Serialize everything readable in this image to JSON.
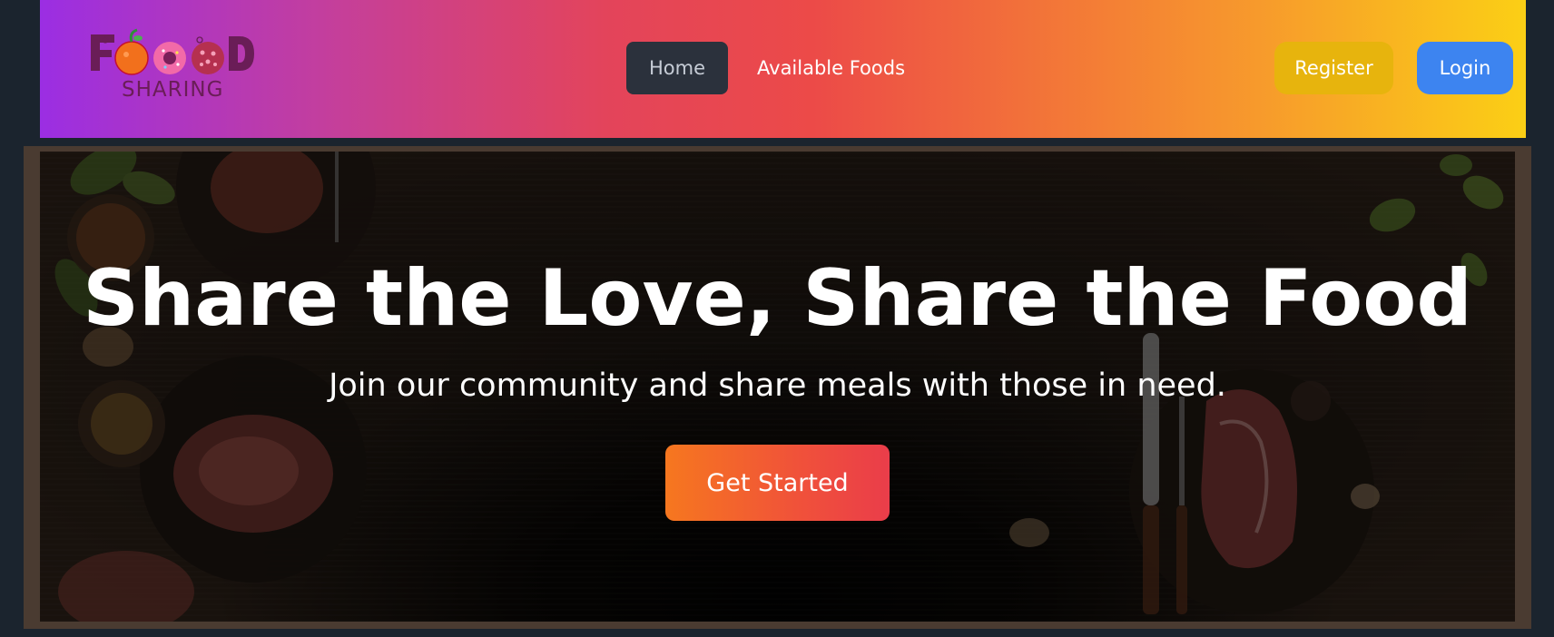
{
  "brand": {
    "logo_word": "FOOD",
    "logo_sub": "SHARING"
  },
  "nav": {
    "home": "Home",
    "available_foods": "Available Foods",
    "register": "Register",
    "login": "Login"
  },
  "hero": {
    "title": "Share the Love, Share the Food",
    "subtitle": "Join our community and share meals with those in need.",
    "cta": "Get Started"
  },
  "colors": {
    "nav_gradient_start": "#9b2ee3",
    "nav_gradient_end": "#fbcf15",
    "home_bg": "#2b313c",
    "register_bg": "#e7b40d",
    "login_bg": "#3d84f0",
    "cta_start": "#f6771f",
    "cta_end": "#ea3d4a",
    "page_bg": "#1b242e"
  },
  "icons": {
    "logo_letters": [
      "tomato-icon",
      "donut-icon",
      "cookie-icon"
    ]
  }
}
